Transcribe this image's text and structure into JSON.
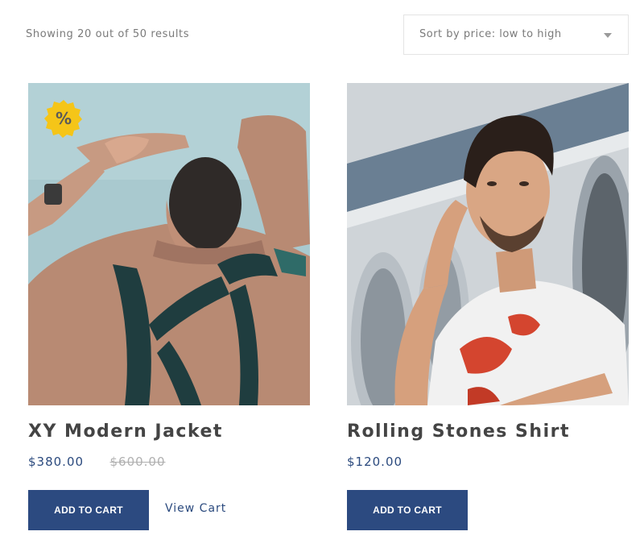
{
  "results": {
    "text": "Showing 20 out of 50 results"
  },
  "sort": {
    "selected": "Sort by price: low to high"
  },
  "products": [
    {
      "title": "XY Modern Jacket",
      "price": "$380.00",
      "old_price": "$600.00",
      "on_sale": true,
      "sale_badge": "%",
      "add_to_cart_label": "ADD TO CART",
      "view_cart_label": "View Cart",
      "image": "man-in-jacket-photo"
    },
    {
      "title": "Rolling Stones Shirt",
      "price": "$120.00",
      "on_sale": false,
      "add_to_cart_label": "ADD TO CART",
      "image": "man-in-laundromat-photo"
    }
  ],
  "colors": {
    "accent": "#2c4a80",
    "price": "#2b4a7e",
    "sale_badge": "#f5c518",
    "muted_text": "#7a7a7a"
  }
}
